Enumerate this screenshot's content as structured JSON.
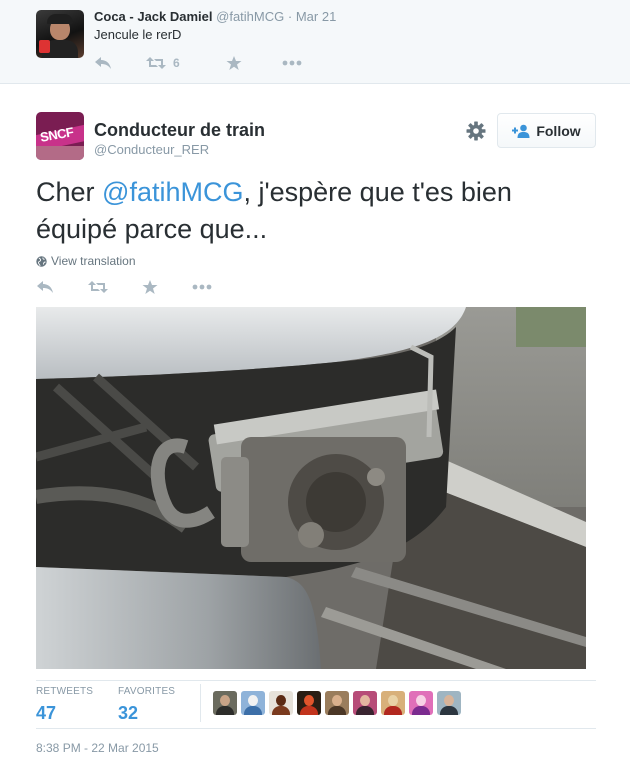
{
  "reply_context": {
    "name": "Coca - Jack Damiel",
    "handle": "@fatihMCG",
    "date": "Mar 21",
    "separator": "·",
    "text": "Jencule le rerD",
    "retweet_count": "6",
    "icons": [
      "reply-icon",
      "retweet-icon",
      "favorite-icon",
      "more-icon"
    ]
  },
  "tweet": {
    "name": "Conducteur de train",
    "handle": "@Conducteur_RER",
    "text_before": "Cher ",
    "mention": "@fatihMCG",
    "text_after": ", j'espère que t'es bien équipé parce que...",
    "translate_label": "View translation",
    "follow_label": "Follow",
    "avatar_logo_text": "SNCF",
    "icons": [
      "gear-icon",
      "follow-person-icon",
      "globe-icon",
      "reply-icon",
      "retweet-icon",
      "favorite-icon",
      "more-icon"
    ]
  },
  "stats": {
    "retweets_label": "RETWEETS",
    "retweets_value": "47",
    "favorites_label": "FAVORITES",
    "favorites_value": "32",
    "favoriter_avatar_count": 9
  },
  "timestamp": "8:38 PM - 22 Mar 2015",
  "colors": {
    "link": "#3b94d9",
    "muted": "#8899a6",
    "icon": "#aab8c2",
    "text": "#292f33",
    "context_bg": "#f5f8fa",
    "border": "#e1e8ed"
  }
}
